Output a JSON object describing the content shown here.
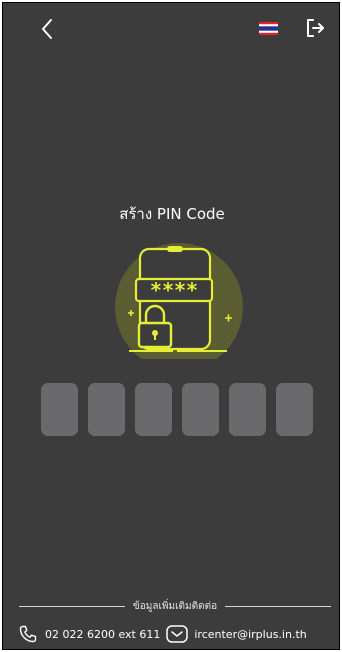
{
  "header": {
    "back_icon": "chevron-left-icon",
    "flag_icon": "thailand-flag-icon",
    "logout_icon": "logout-icon"
  },
  "main": {
    "title": "สร้าง PIN Code",
    "illustration_icon": "phone-password-lock-icon",
    "pin_boxes": 6
  },
  "footer": {
    "contact_heading": "ข้อมูลเพิ่มเติมติดต่อ",
    "phone": "02 022 6200 ext 611",
    "email": "ircenter@irplus.in.th"
  },
  "colors": {
    "background": "#3c3c3c",
    "accent": "#e4ee35",
    "pin_box": "#6a6a6c",
    "text": "#ffffff"
  }
}
